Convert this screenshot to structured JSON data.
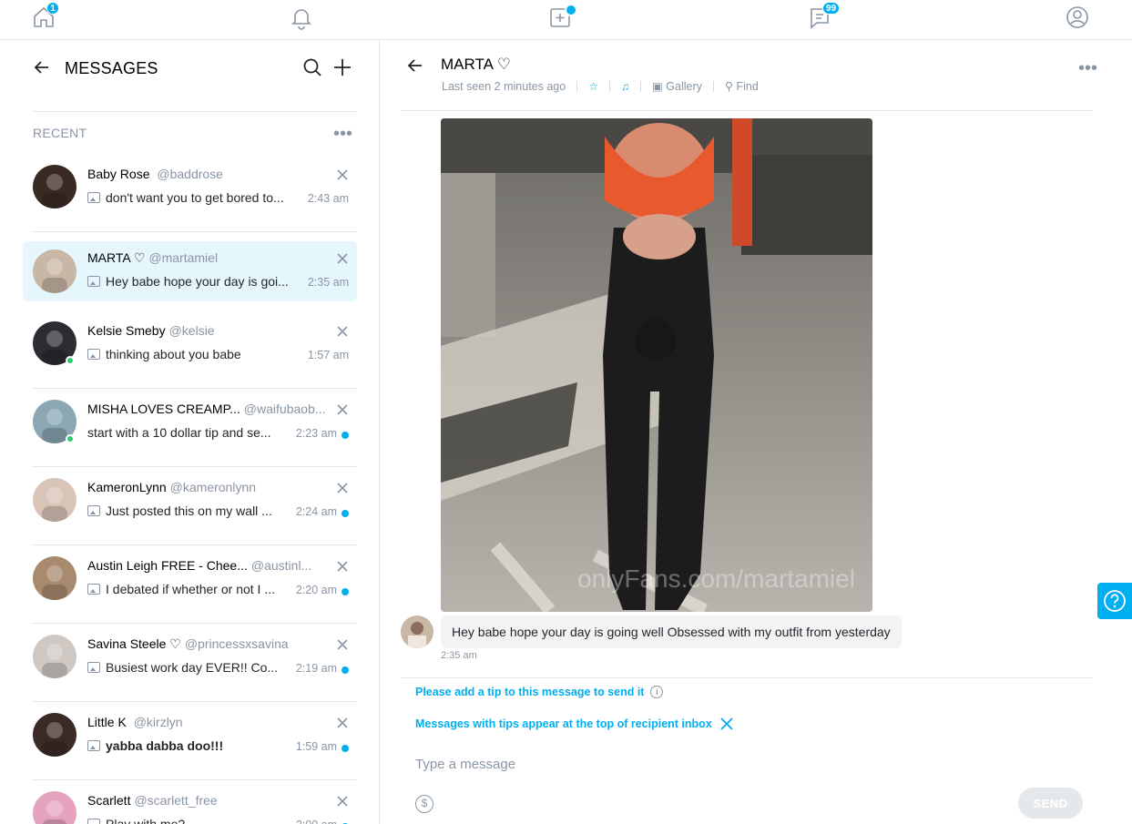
{
  "nav": {
    "home_badge": "1",
    "messages_badge": "99"
  },
  "left": {
    "title": "MESSAGES",
    "recent_label": "RECENT",
    "more": "•••",
    "chats": [
      {
        "name": "Baby Rose ",
        "handle": "@baddrose",
        "preview": "don't want you to get bored to...",
        "time": "2:43 am",
        "has_image": true,
        "bold": false,
        "unread": false,
        "online": false,
        "active": false,
        "avatar_color": "#3a2a24"
      },
      {
        "name": "MARTA ♡",
        "handle": "@martamiel",
        "preview": "Hey babe hope your day is goi...",
        "time": "2:35 am",
        "has_image": true,
        "bold": false,
        "unread": false,
        "online": false,
        "active": true,
        "avatar_color": "#c9b7a6"
      },
      {
        "name": "Kelsie Smeby",
        "handle": "@kelsie",
        "preview": "thinking about you babe ",
        "time": "1:57 am",
        "has_image": true,
        "bold": false,
        "unread": false,
        "online": true,
        "active": false,
        "avatar_color": "#2b2d33"
      },
      {
        "name": "MISHA LOVES CREAMP...",
        "handle": "@waifubaob...",
        "preview": "start with a 10 dollar tip and se...",
        "time": "2:23 am",
        "has_image": false,
        "bold": false,
        "unread": true,
        "online": true,
        "active": false,
        "avatar_color": "#8aa7b3"
      },
      {
        "name": "KameronLynn",
        "handle": "@kameronlynn",
        "preview": "Just posted this on my wall ...",
        "time": "2:24 am",
        "has_image": true,
        "bold": false,
        "unread": true,
        "online": false,
        "active": false,
        "avatar_color": "#d9c5b8"
      },
      {
        "name": "Austin Leigh  FREE - Chee...",
        "handle": "@austinl...",
        "preview": "I debated if whether or not I ...",
        "time": "2:20 am",
        "has_image": true,
        "bold": false,
        "unread": true,
        "online": false,
        "active": false,
        "avatar_color": "#a88a6e"
      },
      {
        "name": "Savina Steele ♡",
        "handle": "@princessxsavina",
        "preview": "Busiest work day EVER!! Co...",
        "time": "2:19 am",
        "has_image": true,
        "bold": false,
        "unread": true,
        "online": false,
        "active": false,
        "avatar_color": "#cfc8c2"
      },
      {
        "name": "Little K ",
        "handle": "@kirzlyn",
        "preview": "yabba dabba doo!!!  ",
        "time": "1:59 am",
        "has_image": true,
        "bold": true,
        "unread": true,
        "online": false,
        "active": false,
        "avatar_color": "#3b2a26"
      },
      {
        "name": "Scarlett",
        "handle": "@scarlett_free",
        "preview": "Play with me?",
        "time": "2:00 am",
        "has_image": true,
        "bold": false,
        "unread": true,
        "online": false,
        "active": false,
        "avatar_color": "#e6a3c0"
      }
    ]
  },
  "conversation": {
    "name": "MARTA ♡",
    "last_seen": "Last seen 2 minutes ago",
    "gallery": "Gallery",
    "find": "Find",
    "watermark": "onlyFans.com/martamiel",
    "message_text": "Hey babe hope your day is going well  Obsessed with my outfit from yesterday ",
    "message_time": "2:35 am",
    "tip_note": "Please add a tip to this message to send it",
    "tip_note2": "Messages with tips appear at the top of recipient inbox",
    "input_placeholder": "Type a message",
    "send_label": "SEND"
  },
  "colors": {
    "accent": "#00aff0",
    "muted": "#8a96a3"
  }
}
